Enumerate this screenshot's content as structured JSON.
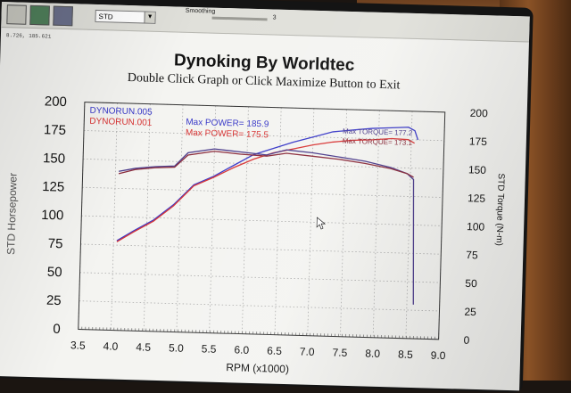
{
  "toolbar": {
    "dropdown_value": "STD",
    "smoothing_label": "Smoothing",
    "smoothing_value": "3"
  },
  "coords_readout": "8.726, 185.621",
  "title": "Dynoking By Worldtec",
  "subtitle": "Double Click Graph or Click Maximize Button to Exit",
  "legend": {
    "run1": "DYNORUN.005",
    "run1_max_power": "Max POWER= 185.9",
    "run2": "DYNORUN.001",
    "run2_max_power": "Max POWER= 175.5",
    "run1_max_torque": "Max TORQUE= 177.2",
    "run2_max_torque": "Max TORQUE= 173.1"
  },
  "colors": {
    "run1": "#3838c8",
    "run2": "#d83434",
    "torque1": "#4a3a8a",
    "torque2": "#8a2a3a"
  },
  "chart_data": {
    "type": "line",
    "xlabel": "RPM (x1000)",
    "ylabel_left": "STD Horsepower",
    "ylabel_right": "STD Torque (N-m)",
    "xlim": [
      3.5,
      9.0
    ],
    "ylim_left": [
      0,
      200
    ],
    "ylim_right": [
      0,
      200
    ],
    "x_ticks": [
      "3.5",
      "4.0",
      "4.5",
      "5.0",
      "5.5",
      "6.0",
      "6.5",
      "7.0",
      "7.5",
      "8.0",
      "8.5",
      "9.0"
    ],
    "y_ticks_left": [
      "0",
      "25",
      "50",
      "75",
      "100",
      "125",
      "150",
      "175",
      "200"
    ],
    "y_ticks_right": [
      "0",
      "25",
      "50",
      "75",
      "100",
      "125",
      "150",
      "175",
      "200"
    ],
    "grid": true,
    "series": [
      {
        "name": "DYNORUN.005",
        "axis": "left",
        "x": [
          4.05,
          4.3,
          4.6,
          4.9,
          5.2,
          5.5,
          5.8,
          6.1,
          6.4,
          6.7,
          7.0,
          7.3,
          7.6,
          7.9,
          8.2,
          8.45,
          8.55,
          8.6
        ],
        "y": [
          79,
          88,
          98,
          112,
          130,
          138,
          148,
          158,
          164,
          170,
          175,
          180,
          182,
          184,
          185,
          185.9,
          183,
          175
        ]
      },
      {
        "name": "DYNORUN.001",
        "axis": "left",
        "x": [
          4.05,
          4.3,
          4.6,
          4.9,
          5.2,
          5.5,
          5.8,
          6.1,
          6.4,
          6.7,
          7.0,
          7.3,
          7.6,
          7.9,
          8.2,
          8.45,
          8.55
        ],
        "y": [
          78,
          87,
          97,
          111,
          129,
          137,
          146,
          154,
          160,
          164,
          168,
          171,
          173,
          174,
          175.5,
          175,
          172
        ]
      },
      {
        "name": "DYNORUN.005 torque",
        "axis": "right",
        "x": [
          4.05,
          4.3,
          4.6,
          4.9,
          5.1,
          5.5,
          5.9,
          6.3,
          6.6,
          7.0,
          7.4,
          7.8,
          8.2,
          8.45,
          8.55,
          8.6
        ],
        "y": [
          140,
          143,
          145,
          146,
          158,
          162,
          160,
          158,
          163,
          161,
          158,
          155,
          150,
          145,
          140,
          30
        ]
      },
      {
        "name": "DYNORUN.001 torque",
        "axis": "right",
        "x": [
          4.05,
          4.3,
          4.6,
          4.9,
          5.1,
          5.5,
          5.9,
          6.3,
          6.6,
          7.0,
          7.4,
          7.8,
          8.2,
          8.45,
          8.55
        ],
        "y": [
          138,
          142,
          144,
          145,
          156,
          160,
          158,
          157,
          160,
          158,
          156,
          153,
          149,
          145,
          142
        ]
      }
    ]
  }
}
